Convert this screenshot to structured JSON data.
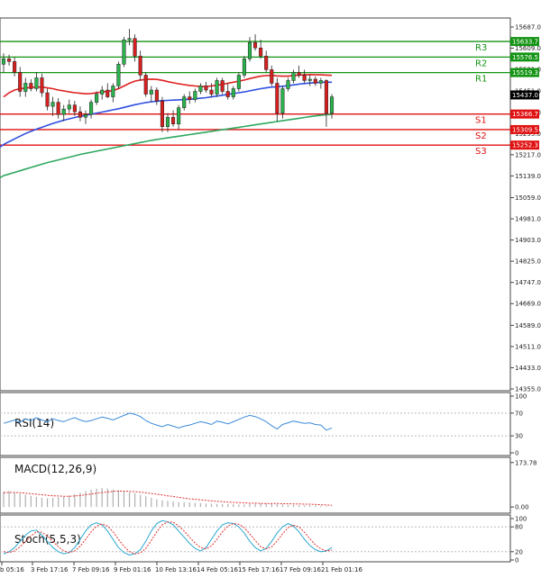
{
  "colors": {
    "up": "#2bb24c",
    "down": "#d62020",
    "resistance": "#149414",
    "support": "#e01010",
    "ma_fast": "#e02020",
    "ma_mid": "#3050e0",
    "ma_slow": "#2fa860",
    "rsi": "#3a8ad8",
    "macd_hist": "#b0b0b0",
    "macd_signal": "#e03030",
    "stoch_main": "#2aa8d0",
    "stoch_signal": "#e03030",
    "current_price": "#000000"
  },
  "chart_data": [
    {
      "type": "candlestick",
      "title": "",
      "x_labels": [
        "b 05:16",
        "3 Feb 17:16",
        "7 Feb 09:16",
        "9 Feb 01:16",
        "10 Feb 13:16",
        "14 Feb 05:16",
        "15 Feb 17:16",
        "17 Feb 09:16",
        "21 Feb 01:16"
      ],
      "y_ticks": [
        "15687.0",
        "15609.0",
        "15531.0",
        "15451.0",
        "15373.0",
        "15295.0",
        "15217.0",
        "15139.0",
        "15059.0",
        "14981.0",
        "14903.0",
        "14825.0",
        "14747.0",
        "14669.0",
        "14589.0",
        "14511.0",
        "14433.0",
        "14355.0"
      ],
      "ylim": [
        14355,
        15687
      ],
      "current_price": "15437.0",
      "levels": [
        {
          "name": "R3",
          "value": 15633.7,
          "label": "15633.7",
          "kind": "resistance"
        },
        {
          "name": "R2",
          "value": 15576.5,
          "label": "15576.5",
          "kind": "resistance"
        },
        {
          "name": "R1",
          "value": 15519.3,
          "label": "15519.3",
          "kind": "resistance"
        },
        {
          "name": "S1",
          "value": 15366.7,
          "label": "15366.7",
          "kind": "support"
        },
        {
          "name": "S2",
          "value": 15309.5,
          "label": "15309.5",
          "kind": "support"
        },
        {
          "name": "S3",
          "value": 15252.3,
          "label": "15252.3",
          "kind": "support"
        }
      ],
      "candles": [
        [
          15550,
          15590,
          15520,
          15570
        ],
        [
          15570,
          15585,
          15545,
          15560
        ],
        [
          15560,
          15575,
          15505,
          15520
        ],
        [
          15520,
          15540,
          15430,
          15450
        ],
        [
          15450,
          15500,
          15430,
          15480
        ],
        [
          15480,
          15495,
          15450,
          15460
        ],
        [
          15460,
          15520,
          15450,
          15500
        ],
        [
          15500,
          15515,
          15430,
          15445
        ],
        [
          15445,
          15460,
          15380,
          15395
        ],
        [
          15395,
          15430,
          15360,
          15410
        ],
        [
          15410,
          15425,
          15350,
          15365
        ],
        [
          15365,
          15400,
          15340,
          15385
        ],
        [
          15385,
          15420,
          15370,
          15400
        ],
        [
          15400,
          15415,
          15360,
          15375
        ],
        [
          15375,
          15395,
          15340,
          15355
        ],
        [
          15355,
          15380,
          15330,
          15365
        ],
        [
          15365,
          15420,
          15350,
          15410
        ],
        [
          15410,
          15450,
          15400,
          15440
        ],
        [
          15440,
          15470,
          15420,
          15455
        ],
        [
          15455,
          15480,
          15425,
          15430
        ],
        [
          15430,
          15480,
          15410,
          15470
        ],
        [
          15470,
          15560,
          15460,
          15550
        ],
        [
          15550,
          15650,
          15540,
          15640
        ],
        [
          15640,
          15680,
          15620,
          15645
        ],
        [
          15645,
          15660,
          15560,
          15580
        ],
        [
          15580,
          15600,
          15490,
          15510
        ],
        [
          15510,
          15520,
          15430,
          15440
        ],
        [
          15440,
          15470,
          15410,
          15455
        ],
        [
          15455,
          15465,
          15400,
          15415
        ],
        [
          15415,
          15430,
          15300,
          15320
        ],
        [
          15320,
          15370,
          15300,
          15355
        ],
        [
          15355,
          15380,
          15320,
          15330
        ],
        [
          15330,
          15400,
          15310,
          15390
        ],
        [
          15390,
          15440,
          15380,
          15430
        ],
        [
          15430,
          15450,
          15405,
          15420
        ],
        [
          15420,
          15460,
          15410,
          15450
        ],
        [
          15450,
          15480,
          15440,
          15470
        ],
        [
          15470,
          15485,
          15445,
          15455
        ],
        [
          15455,
          15480,
          15430,
          15440
        ],
        [
          15440,
          15500,
          15430,
          15490
        ],
        [
          15490,
          15500,
          15440,
          15450
        ],
        [
          15450,
          15480,
          15420,
          15430
        ],
        [
          15430,
          15470,
          15420,
          15460
        ],
        [
          15460,
          15520,
          15450,
          15510
        ],
        [
          15510,
          15580,
          15500,
          15570
        ],
        [
          15570,
          15650,
          15560,
          15630
        ],
        [
          15630,
          15660,
          15600,
          15610
        ],
        [
          15610,
          15640,
          15570,
          15580
        ],
        [
          15580,
          15600,
          15520,
          15530
        ],
        [
          15530,
          15545,
          15470,
          15480
        ],
        [
          15480,
          15500,
          15340,
          15370
        ],
        [
          15370,
          15470,
          15350,
          15460
        ],
        [
          15460,
          15500,
          15450,
          15490
        ],
        [
          15490,
          15530,
          15480,
          15520
        ],
        [
          15520,
          15545,
          15500,
          15510
        ],
        [
          15510,
          15530,
          15480,
          15490
        ],
        [
          15490,
          15510,
          15470,
          15495
        ],
        [
          15495,
          15505,
          15470,
          15480
        ],
        [
          15480,
          15500,
          15460,
          15490
        ],
        [
          15490,
          15495,
          15320,
          15370
        ],
        [
          15370,
          15440,
          15350,
          15430
        ]
      ],
      "ma_fast": [
        15430,
        15445,
        15455,
        15460,
        15462,
        15465,
        15466,
        15466,
        15463,
        15460,
        15455,
        15452,
        15448,
        15445,
        15443,
        15441,
        15442,
        15445,
        15448,
        15450,
        15453,
        15460,
        15470,
        15480,
        15488,
        15492,
        15494,
        15495,
        15494,
        15491,
        15486,
        15482,
        15478,
        15475,
        15472,
        15470,
        15468,
        15468,
        15470,
        15473,
        15476,
        15480,
        15484,
        15488,
        15492,
        15497,
        15502,
        15506,
        15508,
        15509,
        15507,
        15506,
        15506,
        15508,
        15510,
        15511,
        15512,
        15511,
        15511,
        15510,
        15509
      ],
      "ma_mid": [
        15255,
        15265,
        15275,
        15285,
        15295,
        15303,
        15311,
        15318,
        15325,
        15332,
        15338,
        15344,
        15349,
        15354,
        15358,
        15362,
        15366,
        15370,
        15374,
        15378,
        15382,
        15386,
        15391,
        15396,
        15401,
        15405,
        15409,
        15412,
        15414,
        15416,
        15417,
        15418,
        15419,
        15420,
        15421,
        15423,
        15425,
        15427,
        15430,
        15433,
        15436,
        15439,
        15442,
        15445,
        15448,
        15452,
        15456,
        15460,
        15463,
        15466,
        15467,
        15469,
        15471,
        15474,
        15477,
        15479,
        15481,
        15482,
        15484,
        15484,
        15484
      ],
      "ma_slow": [
        15140,
        15146,
        15152,
        15158,
        15164,
        15170,
        15176,
        15182,
        15188,
        15193,
        15198,
        15203,
        15208,
        15213,
        15218,
        15222,
        15226,
        15230,
        15234,
        15238,
        15242,
        15246,
        15250,
        15254,
        15258,
        15262,
        15266,
        15270,
        15273,
        15276,
        15279,
        15282,
        15285,
        15288,
        15291,
        15294,
        15297,
        15300,
        15303,
        15306,
        15309,
        15312,
        15315,
        15318,
        15321,
        15324,
        15327,
        15330,
        15333,
        15336,
        15339,
        15342,
        15345,
        15348,
        15351,
        15354,
        15357,
        15360,
        15362,
        15364,
        15366
      ]
    },
    {
      "type": "line",
      "name": "RSI(14)",
      "label": "RSI(14)",
      "y_ticks": [
        "100",
        "70",
        "30",
        "0"
      ],
      "ylim": [
        0,
        100
      ],
      "values": [
        52,
        55,
        58,
        54,
        60,
        57,
        62,
        58,
        55,
        60,
        57,
        55,
        59,
        62,
        58,
        55,
        57,
        60,
        63,
        61,
        58,
        62,
        66,
        70,
        68,
        64,
        57,
        52,
        49,
        46,
        50,
        47,
        44,
        47,
        49,
        52,
        55,
        53,
        50,
        56,
        54,
        51,
        55,
        59,
        63,
        66,
        64,
        60,
        55,
        48,
        42,
        50,
        53,
        56,
        54,
        52,
        53,
        50,
        49,
        40,
        44
      ]
    },
    {
      "type": "bar",
      "name": "MACD(12,26,9)",
      "label": "MACD(12,26,9)",
      "y_ticks": [
        "173.78",
        "0.00"
      ],
      "right_label": "0.00",
      "ylim": [
        -10,
        180
      ],
      "histogram": [
        60,
        62,
        58,
        52,
        48,
        44,
        40,
        36,
        34,
        36,
        38,
        40,
        44,
        50,
        56,
        62,
        68,
        72,
        74,
        72,
        68,
        66,
        62,
        58,
        54,
        48,
        42,
        36,
        30,
        26,
        24,
        22,
        20,
        19,
        18,
        16,
        15,
        14,
        13,
        12,
        12,
        11,
        11,
        10,
        10,
        12,
        13,
        14,
        15,
        14,
        12,
        10,
        9,
        8,
        8,
        7,
        7,
        6,
        5,
        3,
        2
      ],
      "signal": [
        56,
        57,
        57,
        56,
        54,
        52,
        50,
        48,
        46,
        44,
        43,
        42,
        42,
        43,
        45,
        48,
        51,
        54,
        57,
        59,
        61,
        62,
        62,
        61,
        60,
        58,
        56,
        53,
        50,
        47,
        44,
        41,
        38,
        35,
        32,
        30,
        28,
        26,
        24,
        22,
        21,
        19,
        18,
        17,
        16,
        15,
        15,
        14,
        14,
        14,
        14,
        13,
        13,
        12,
        12,
        11,
        11,
        10,
        9,
        8,
        7
      ]
    },
    {
      "type": "line",
      "name": "Stoch(5,5,3)",
      "label": "Stoch(5,5,3)",
      "y_ticks": [
        "100",
        "80",
        "20",
        "0"
      ],
      "ylim": [
        0,
        100
      ],
      "main": [
        15,
        20,
        30,
        45,
        60,
        70,
        72,
        60,
        45,
        30,
        20,
        15,
        18,
        30,
        50,
        70,
        85,
        90,
        85,
        70,
        50,
        30,
        18,
        12,
        15,
        25,
        45,
        70,
        88,
        95,
        92,
        85,
        70,
        55,
        40,
        28,
        22,
        30,
        50,
        70,
        85,
        90,
        88,
        80,
        65,
        45,
        30,
        22,
        28,
        45,
        65,
        80,
        88,
        82,
        68,
        50,
        35,
        25,
        20,
        22,
        30
      ],
      "signal": [
        20,
        18,
        22,
        32,
        45,
        58,
        68,
        67,
        58,
        45,
        32,
        22,
        18,
        22,
        33,
        50,
        68,
        82,
        87,
        82,
        68,
        50,
        33,
        20,
        15,
        17,
        28,
        47,
        68,
        85,
        92,
        91,
        82,
        70,
        55,
        41,
        30,
        27,
        34,
        50,
        68,
        82,
        88,
        86,
        78,
        63,
        47,
        32,
        27,
        32,
        46,
        63,
        78,
        84,
        80,
        67,
        51,
        37,
        27,
        22,
        24
      ]
    }
  ]
}
